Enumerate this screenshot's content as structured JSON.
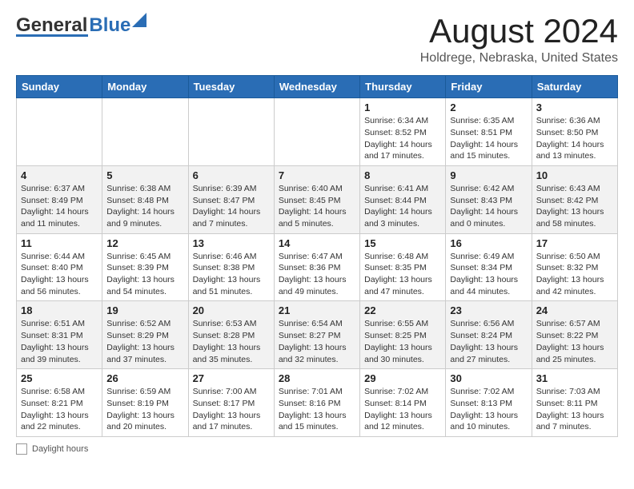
{
  "header": {
    "logo_general": "General",
    "logo_blue": "Blue",
    "month_title": "August 2024",
    "location": "Holdrege, Nebraska, United States"
  },
  "days_of_week": [
    "Sunday",
    "Monday",
    "Tuesday",
    "Wednesday",
    "Thursday",
    "Friday",
    "Saturday"
  ],
  "weeks": [
    [
      {
        "day": "",
        "info": ""
      },
      {
        "day": "",
        "info": ""
      },
      {
        "day": "",
        "info": ""
      },
      {
        "day": "",
        "info": ""
      },
      {
        "day": "1",
        "info": "Sunrise: 6:34 AM\nSunset: 8:52 PM\nDaylight: 14 hours and 17 minutes."
      },
      {
        "day": "2",
        "info": "Sunrise: 6:35 AM\nSunset: 8:51 PM\nDaylight: 14 hours and 15 minutes."
      },
      {
        "day": "3",
        "info": "Sunrise: 6:36 AM\nSunset: 8:50 PM\nDaylight: 14 hours and 13 minutes."
      }
    ],
    [
      {
        "day": "4",
        "info": "Sunrise: 6:37 AM\nSunset: 8:49 PM\nDaylight: 14 hours and 11 minutes."
      },
      {
        "day": "5",
        "info": "Sunrise: 6:38 AM\nSunset: 8:48 PM\nDaylight: 14 hours and 9 minutes."
      },
      {
        "day": "6",
        "info": "Sunrise: 6:39 AM\nSunset: 8:47 PM\nDaylight: 14 hours and 7 minutes."
      },
      {
        "day": "7",
        "info": "Sunrise: 6:40 AM\nSunset: 8:45 PM\nDaylight: 14 hours and 5 minutes."
      },
      {
        "day": "8",
        "info": "Sunrise: 6:41 AM\nSunset: 8:44 PM\nDaylight: 14 hours and 3 minutes."
      },
      {
        "day": "9",
        "info": "Sunrise: 6:42 AM\nSunset: 8:43 PM\nDaylight: 14 hours and 0 minutes."
      },
      {
        "day": "10",
        "info": "Sunrise: 6:43 AM\nSunset: 8:42 PM\nDaylight: 13 hours and 58 minutes."
      }
    ],
    [
      {
        "day": "11",
        "info": "Sunrise: 6:44 AM\nSunset: 8:40 PM\nDaylight: 13 hours and 56 minutes."
      },
      {
        "day": "12",
        "info": "Sunrise: 6:45 AM\nSunset: 8:39 PM\nDaylight: 13 hours and 54 minutes."
      },
      {
        "day": "13",
        "info": "Sunrise: 6:46 AM\nSunset: 8:38 PM\nDaylight: 13 hours and 51 minutes."
      },
      {
        "day": "14",
        "info": "Sunrise: 6:47 AM\nSunset: 8:36 PM\nDaylight: 13 hours and 49 minutes."
      },
      {
        "day": "15",
        "info": "Sunrise: 6:48 AM\nSunset: 8:35 PM\nDaylight: 13 hours and 47 minutes."
      },
      {
        "day": "16",
        "info": "Sunrise: 6:49 AM\nSunset: 8:34 PM\nDaylight: 13 hours and 44 minutes."
      },
      {
        "day": "17",
        "info": "Sunrise: 6:50 AM\nSunset: 8:32 PM\nDaylight: 13 hours and 42 minutes."
      }
    ],
    [
      {
        "day": "18",
        "info": "Sunrise: 6:51 AM\nSunset: 8:31 PM\nDaylight: 13 hours and 39 minutes."
      },
      {
        "day": "19",
        "info": "Sunrise: 6:52 AM\nSunset: 8:29 PM\nDaylight: 13 hours and 37 minutes."
      },
      {
        "day": "20",
        "info": "Sunrise: 6:53 AM\nSunset: 8:28 PM\nDaylight: 13 hours and 35 minutes."
      },
      {
        "day": "21",
        "info": "Sunrise: 6:54 AM\nSunset: 8:27 PM\nDaylight: 13 hours and 32 minutes."
      },
      {
        "day": "22",
        "info": "Sunrise: 6:55 AM\nSunset: 8:25 PM\nDaylight: 13 hours and 30 minutes."
      },
      {
        "day": "23",
        "info": "Sunrise: 6:56 AM\nSunset: 8:24 PM\nDaylight: 13 hours and 27 minutes."
      },
      {
        "day": "24",
        "info": "Sunrise: 6:57 AM\nSunset: 8:22 PM\nDaylight: 13 hours and 25 minutes."
      }
    ],
    [
      {
        "day": "25",
        "info": "Sunrise: 6:58 AM\nSunset: 8:21 PM\nDaylight: 13 hours and 22 minutes."
      },
      {
        "day": "26",
        "info": "Sunrise: 6:59 AM\nSunset: 8:19 PM\nDaylight: 13 hours and 20 minutes."
      },
      {
        "day": "27",
        "info": "Sunrise: 7:00 AM\nSunset: 8:17 PM\nDaylight: 13 hours and 17 minutes."
      },
      {
        "day": "28",
        "info": "Sunrise: 7:01 AM\nSunset: 8:16 PM\nDaylight: 13 hours and 15 minutes."
      },
      {
        "day": "29",
        "info": "Sunrise: 7:02 AM\nSunset: 8:14 PM\nDaylight: 13 hours and 12 minutes."
      },
      {
        "day": "30",
        "info": "Sunrise: 7:02 AM\nSunset: 8:13 PM\nDaylight: 13 hours and 10 minutes."
      },
      {
        "day": "31",
        "info": "Sunrise: 7:03 AM\nSunset: 8:11 PM\nDaylight: 13 hours and 7 minutes."
      }
    ]
  ],
  "legend": {
    "label": "Daylight hours"
  }
}
